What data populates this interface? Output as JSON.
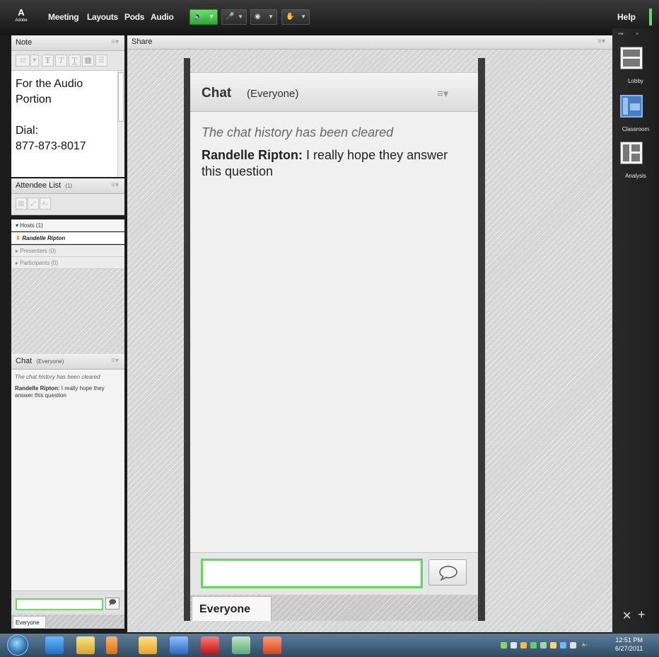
{
  "menubar": {
    "logo": "A",
    "logo_sub": "Adobe",
    "items": [
      "Meeting",
      "Layouts",
      "Pods",
      "Audio"
    ],
    "help": "Help"
  },
  "note_pod": {
    "title": "Note",
    "font_size": "22",
    "lines": [
      "For the Audio",
      "Portion",
      "",
      "Dial:",
      "877-873-8017"
    ]
  },
  "attendee_pod": {
    "title": "Attendee List",
    "count": "(1)",
    "hosts": "Hosts (1)",
    "host_name": "Randelle Ripton",
    "presenters": "Presenters (0)",
    "participants": "Participants (0)"
  },
  "left_chat": {
    "title": "Chat",
    "scope": "(Everyone)",
    "cleared": "The chat history has been cleared",
    "sender": "Randelle Ripton:",
    "message": "I really hope they answer this question",
    "tab": "Everyone"
  },
  "share_pod": {
    "title": "Share"
  },
  "chat_pod": {
    "title": "Chat",
    "scope": "(Everyone)",
    "cleared": "The chat history has been cleared",
    "sender": "Randelle Ripton:",
    "message": "I really hope they answer this question",
    "tab": "Everyone"
  },
  "layouts": [
    {
      "label": "Lobby"
    },
    {
      "label": "Classroom"
    },
    {
      "label": "Analysis"
    }
  ],
  "taskbar": {
    "time": "12:51 PM",
    "date": "6/27/2011"
  },
  "colors": {
    "accent_green": "#67d465",
    "selected_layout": "#4a7cc2"
  }
}
